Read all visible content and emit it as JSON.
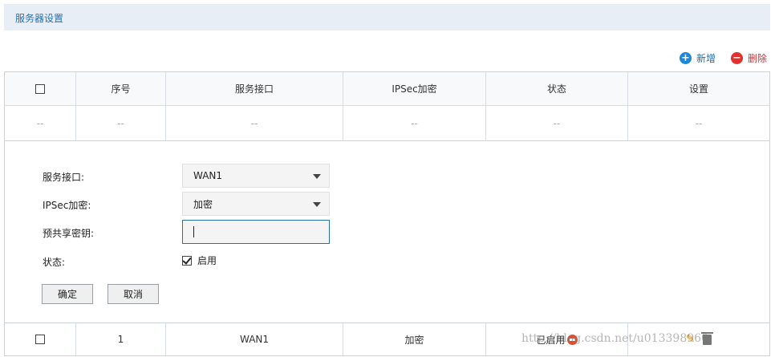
{
  "header": {
    "title": "服务器设置"
  },
  "toolbar": {
    "add_label": "新增",
    "add_icon": "plus-circle-icon",
    "delete_label": "删除",
    "delete_icon": "minus-circle-icon"
  },
  "table": {
    "columns": [
      "",
      "序号",
      "服务接口",
      "IPSec加密",
      "状态",
      "设置"
    ],
    "empty_row": [
      "--",
      "--",
      "--",
      "--",
      "--",
      "--"
    ],
    "rows": [
      {
        "index": "1",
        "interface": "WAN1",
        "ipsec": "加密",
        "status": "已启用",
        "status_icon": "disable-icon",
        "actions": [
          "edit-icon",
          "delete-icon"
        ]
      }
    ]
  },
  "form": {
    "interface_label": "服务接口:",
    "interface_value": "WAN1",
    "ipsec_label": "IPSec加密:",
    "ipsec_value": "加密",
    "psk_label": "预共享密钥:",
    "psk_value": "",
    "status_label": "状态:",
    "status_check_label": "启用",
    "status_checked": true,
    "ok_label": "确定",
    "cancel_label": "取消"
  },
  "watermark": "http://blog.csdn.net/u013398960"
}
